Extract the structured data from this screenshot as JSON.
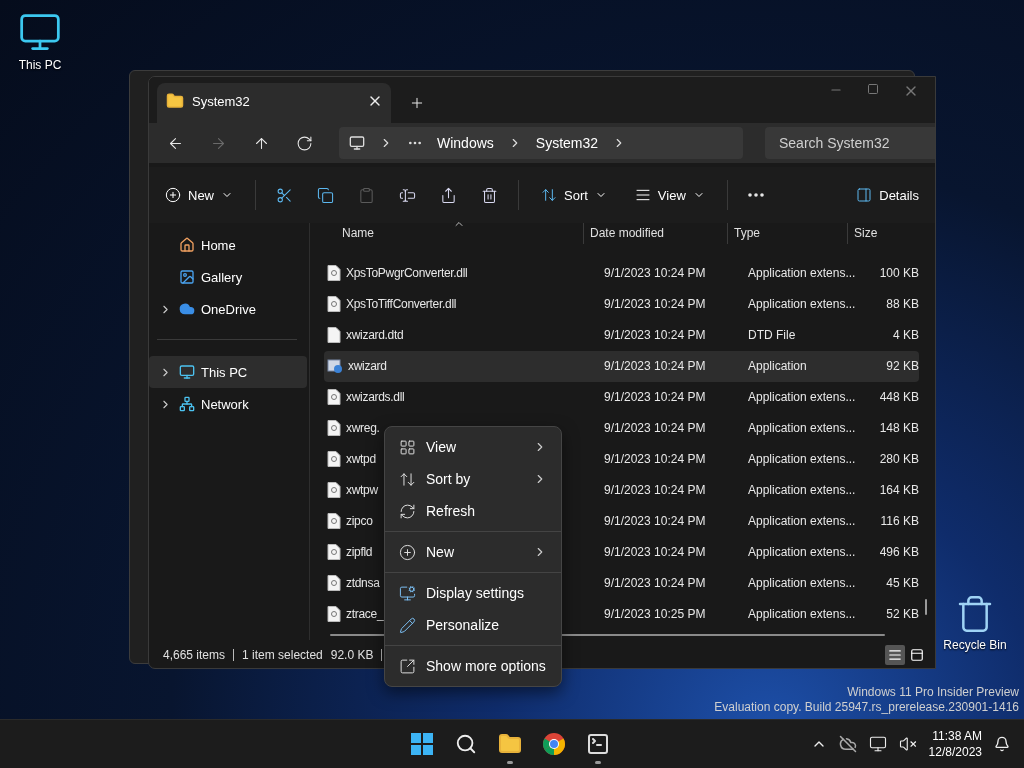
{
  "desktop_icons": [
    {
      "label": "This PC"
    },
    {
      "label": "Recycle Bin"
    }
  ],
  "explorer": {
    "tab": {
      "title": "System32"
    },
    "nav_buttons": [
      {
        "disabled": false
      },
      {
        "disabled": true
      },
      {
        "disabled": false
      },
      {
        "disabled": false
      }
    ],
    "breadcrumb": [
      "Windows",
      "System32"
    ],
    "search": {
      "placeholder": "Search System32"
    },
    "new_button": {
      "label": "New"
    },
    "actions": [
      {
        "disabled": false
      },
      {
        "disabled": false
      },
      {
        "disabled": true
      },
      {
        "disabled": false
      },
      {
        "disabled": false
      },
      {
        "disabled": false
      }
    ],
    "sort_button": {
      "label": "Sort"
    },
    "view_button": {
      "label": "View"
    },
    "details_button": {
      "label": "Details"
    },
    "sidebar": [
      {
        "kind": "item",
        "label": "Home",
        "expandable": false,
        "selected": false
      },
      {
        "kind": "item",
        "label": "Gallery",
        "expandable": false,
        "selected": false
      },
      {
        "kind": "item",
        "label": "OneDrive",
        "expandable": true,
        "selected": false
      },
      {
        "kind": "separator"
      },
      {
        "kind": "item",
        "label": "This PC",
        "expandable": true,
        "selected": true
      },
      {
        "kind": "item",
        "label": "Network",
        "expandable": true,
        "selected": false
      }
    ],
    "columns": [
      "Name",
      "Date modified",
      "Type",
      "Size"
    ],
    "rows": [
      {
        "kind": "dll",
        "name": "XpsToPwgrConverter.dll",
        "date": "9/1/2023 10:24 PM",
        "type": "Application extens...",
        "size": "100 KB",
        "selected": false
      },
      {
        "kind": "dll",
        "name": "XpsToTiffConverter.dll",
        "date": "9/1/2023 10:24 PM",
        "type": "Application extens...",
        "size": "88 KB",
        "selected": false
      },
      {
        "kind": "file",
        "name": "xwizard.dtd",
        "date": "9/1/2023 10:24 PM",
        "type": "DTD File",
        "size": "4 KB",
        "selected": false
      },
      {
        "kind": "app",
        "name": "xwizard",
        "date": "9/1/2023 10:24 PM",
        "type": "Application",
        "size": "92 KB",
        "selected": true
      },
      {
        "kind": "dll",
        "name": "xwizards.dll",
        "date": "9/1/2023 10:24 PM",
        "type": "Application extens...",
        "size": "448 KB",
        "selected": false
      },
      {
        "kind": "dll",
        "name": "xwreg.",
        "date": "9/1/2023 10:24 PM",
        "type": "Application extens...",
        "size": "148 KB",
        "selected": false
      },
      {
        "kind": "dll",
        "name": "xwtpd",
        "date": "9/1/2023 10:24 PM",
        "type": "Application extens...",
        "size": "280 KB",
        "selected": false
      },
      {
        "kind": "dll",
        "name": "xwtpw",
        "date": "9/1/2023 10:24 PM",
        "type": "Application extens...",
        "size": "164 KB",
        "selected": false
      },
      {
        "kind": "dll",
        "name": "zipco",
        "date": "9/1/2023 10:24 PM",
        "type": "Application extens...",
        "size": "116 KB",
        "selected": false
      },
      {
        "kind": "dll",
        "name": "zipfld",
        "date": "9/1/2023 10:24 PM",
        "type": "Application extens...",
        "size": "496 KB",
        "selected": false
      },
      {
        "kind": "dll",
        "name": "ztdnsa",
        "date": "9/1/2023 10:24 PM",
        "type": "Application extens...",
        "size": "45 KB",
        "selected": false
      },
      {
        "kind": "dll",
        "name": "ztrace_",
        "date": "9/1/2023 10:25 PM",
        "type": "Application extens...",
        "size": "52 KB",
        "selected": false
      }
    ],
    "status": {
      "count": "4,665 items",
      "selection": "1 item selected",
      "size": "92.0 KB"
    },
    "view_modes": [
      {
        "selected": true
      },
      {
        "selected": false
      }
    ]
  },
  "context_menu": [
    {
      "kind": "item",
      "label": "View",
      "submenu": true
    },
    {
      "kind": "item",
      "label": "Sort by",
      "submenu": true
    },
    {
      "kind": "item",
      "label": "Refresh",
      "submenu": false
    },
    {
      "kind": "separator"
    },
    {
      "kind": "item",
      "label": "New",
      "submenu": true
    },
    {
      "kind": "separator"
    },
    {
      "kind": "item",
      "label": "Display settings",
      "submenu": false
    },
    {
      "kind": "item",
      "label": "Personalize",
      "submenu": false
    },
    {
      "kind": "separator"
    },
    {
      "kind": "item",
      "label": "Show more options",
      "submenu": false
    }
  ],
  "watermark": [
    "Windows 11 Pro Insider Preview",
    "Evaluation copy. Build 25947.rs_prerelease.230901-1416"
  ],
  "taskbar": {
    "apps": [
      {
        "running": false
      },
      {
        "running": false
      },
      {
        "running": true
      },
      {
        "running": false
      },
      {
        "running": true
      }
    ],
    "clock": {
      "time": "11:38 AM",
      "date": "12/8/2023"
    }
  }
}
